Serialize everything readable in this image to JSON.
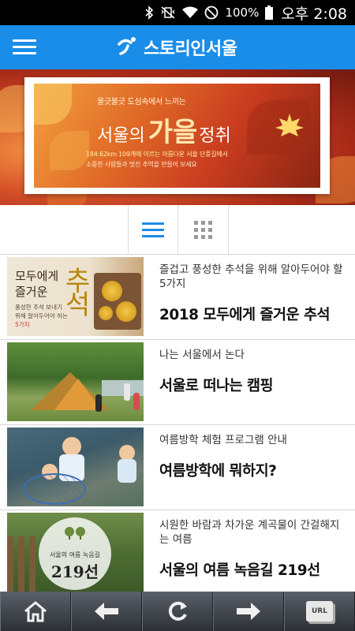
{
  "status_bar": {
    "battery_percent": "100%",
    "time": "오후 2:08",
    "icons": [
      "bluetooth-icon",
      "vibrate-mute-icon",
      "wifi-icon",
      "do-not-disturb-icon",
      "battery-icon"
    ]
  },
  "app_bar": {
    "title": "스토리인서울",
    "menu_icon": "hamburger-menu-icon",
    "logo_icon": "seoul-logo-icon",
    "background": "#1a8de8"
  },
  "banner": {
    "subtitle": "울긋불긋 도심속에서 느끼는",
    "title_part1": "서울의",
    "title_part2": "가을",
    "title_part3": "정취",
    "line1": "184.62km 109개에 이르는 아름다운 서울 단풍길에서",
    "line2": "소중한 사람들과 멋진 추억을 만들어 보세요"
  },
  "view_toggle": {
    "list_icon": "list-view-icon",
    "grid_icon": "grid-view-icon",
    "active": "list",
    "active_color": "#1a8de8"
  },
  "feed": {
    "items": [
      {
        "subtitle": "즐겁고 풍성한 추석을 위해 알아두어야 할 5가지",
        "title": "2018 모두에게 즐거운 추석",
        "thumb": {
          "line1": "모두에게",
          "line2": "즐거운",
          "big": "추석",
          "small1": "풍성한 추석 보내기",
          "small2": "위해 알아두어야 하는",
          "small3": "5가지"
        }
      },
      {
        "subtitle": "나는 서울에서 논다",
        "title": "서울로 떠나는 캠핑"
      },
      {
        "subtitle": "여름방학 체험 프로그램 안내",
        "title": "여름방학에 뭐하지?"
      },
      {
        "subtitle": "시원한 바람과 차가운 계곡물이 간걸해지는 여름",
        "title": "서울의 여름 녹음길 219선",
        "thumb": {
          "sign_small": "서울의 여름 녹음길",
          "sign_big": "219선"
        }
      }
    ]
  },
  "toolbar": {
    "buttons": [
      "home-icon",
      "back-arrow-icon",
      "refresh-icon",
      "forward-arrow-icon",
      "url-icon"
    ],
    "url_label": "URL"
  }
}
